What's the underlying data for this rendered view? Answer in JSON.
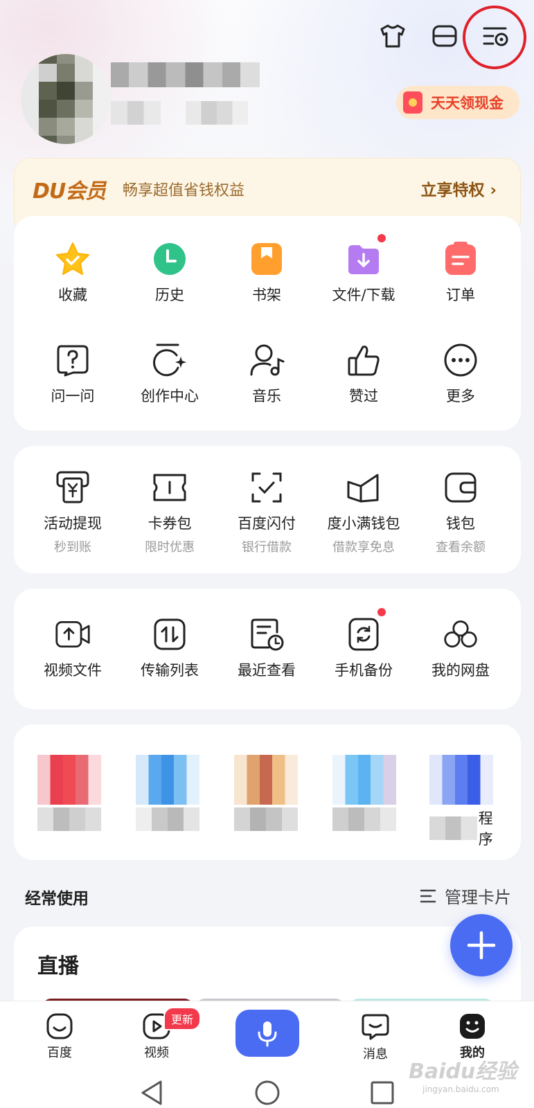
{
  "header": {
    "icons": [
      "tshirt-icon",
      "scan-icon",
      "settings-icon"
    ],
    "cash_button": "天天领现金"
  },
  "du_banner": {
    "logo": "DU会员",
    "slogan": "畅享超值省钱权益",
    "link": "立享特权 ›"
  },
  "grid1": {
    "row1": [
      {
        "label": "收藏",
        "icon": "star-icon"
      },
      {
        "label": "历史",
        "icon": "clock-icon"
      },
      {
        "label": "书架",
        "icon": "bookmark-icon"
      },
      {
        "label": "文件/下载",
        "icon": "download-folder-icon"
      },
      {
        "label": "订单",
        "icon": "order-icon"
      }
    ],
    "row2": [
      {
        "label": "问一问",
        "icon": "question-icon"
      },
      {
        "label": "创作中心",
        "icon": "creation-icon"
      },
      {
        "label": "音乐",
        "icon": "music-icon"
      },
      {
        "label": "赞过",
        "icon": "thumbs-up-icon"
      },
      {
        "label": "更多",
        "icon": "more-icon"
      }
    ]
  },
  "grid2": [
    {
      "label": "活动提现",
      "sub": "秒到账",
      "icon": "cash-withdraw-icon"
    },
    {
      "label": "卡券包",
      "sub": "限时优惠",
      "icon": "coupon-icon"
    },
    {
      "label": "百度闪付",
      "sub": "银行借款",
      "icon": "flash-pay-icon"
    },
    {
      "label": "度小满钱包",
      "sub": "借款享免息",
      "icon": "du-wallet-icon"
    },
    {
      "label": "钱包",
      "sub": "查看余额",
      "icon": "wallet-icon"
    }
  ],
  "grid3": [
    {
      "label": "视频文件",
      "icon": "video-file-icon"
    },
    {
      "label": "传输列表",
      "icon": "transfer-icon"
    },
    {
      "label": "最近查看",
      "icon": "recent-icon"
    },
    {
      "label": "手机备份",
      "icon": "phone-backup-icon"
    },
    {
      "label": "我的网盘",
      "icon": "cloud-drive-icon"
    }
  ],
  "mini_apps": {
    "last_label_tail": "程序"
  },
  "section": {
    "title": "经常使用",
    "manage": "管理卡片"
  },
  "live": {
    "title": "直播"
  },
  "bottom_nav": [
    {
      "label": "百度",
      "icon": "baidu-icon"
    },
    {
      "label": "视频",
      "icon": "video-icon",
      "badge": "更新"
    },
    {
      "label": "消息",
      "icon": "message-icon"
    },
    {
      "label": "我的",
      "icon": "profile-icon"
    }
  ],
  "watermark": {
    "text": "Baidu经验",
    "sub": "jingyan.baidu.com"
  },
  "colors": {
    "accent": "#4a6cf2",
    "highlight_ring": "#e0202a",
    "badge": "#f23a4c"
  }
}
